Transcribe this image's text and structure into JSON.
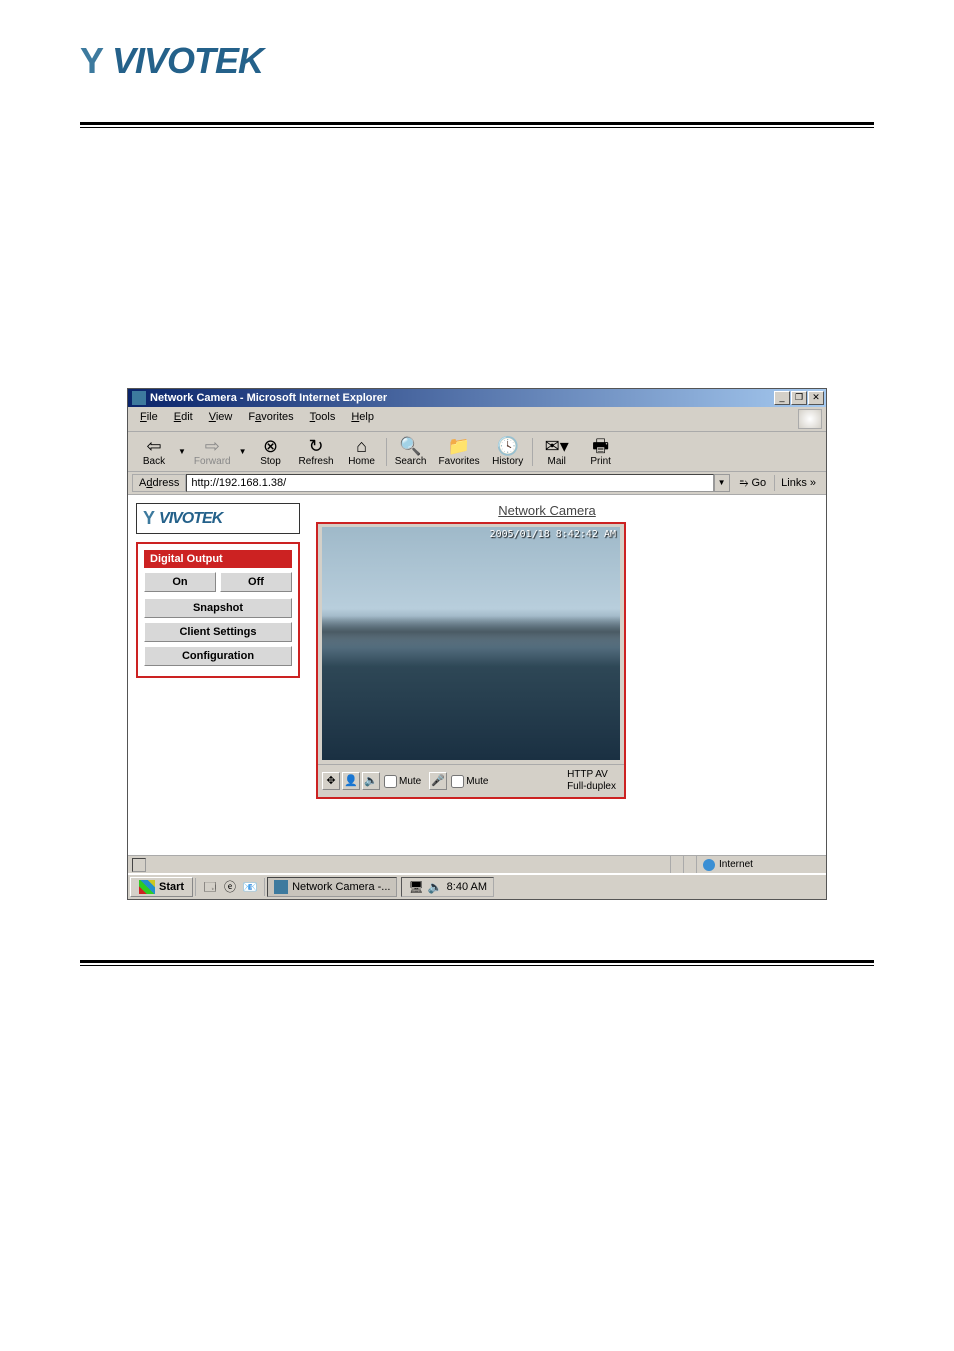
{
  "brand": {
    "name": "VIVOTEK",
    "icon_glyph": "Y"
  },
  "browser": {
    "title": "Network Camera - Microsoft Internet Explorer",
    "menubar": {
      "file": "File",
      "edit": "Edit",
      "view": "View",
      "favorites": "Favorites",
      "tools": "Tools",
      "help": "Help"
    },
    "toolbar": {
      "back": "Back",
      "forward": "Forward",
      "stop": "Stop",
      "refresh": "Refresh",
      "home": "Home",
      "search": "Search",
      "favorites": "Favorites",
      "history": "History",
      "mail": "Mail",
      "print": "Print"
    },
    "addressbar": {
      "label": "Address",
      "value": "http://192.168.1.38/",
      "go": "Go",
      "links": "Links »"
    },
    "status": {
      "zone": "Internet"
    }
  },
  "camera": {
    "page_title": "Network Camera",
    "timestamp": "2005/01/18 8:42:42 AM",
    "controls": {
      "digital_output_header": "Digital Output",
      "on": "On",
      "off": "Off",
      "snapshot": "Snapshot",
      "client_settings": "Client Settings",
      "configuration": "Configuration"
    },
    "video_bar": {
      "mute1": "Mute",
      "mute2": "Mute",
      "status_line1": "HTTP  AV",
      "status_line2": "Full-duplex"
    }
  },
  "taskbar": {
    "start": "Start",
    "task_label": "Network Camera -...",
    "clock": "8:40 AM"
  }
}
